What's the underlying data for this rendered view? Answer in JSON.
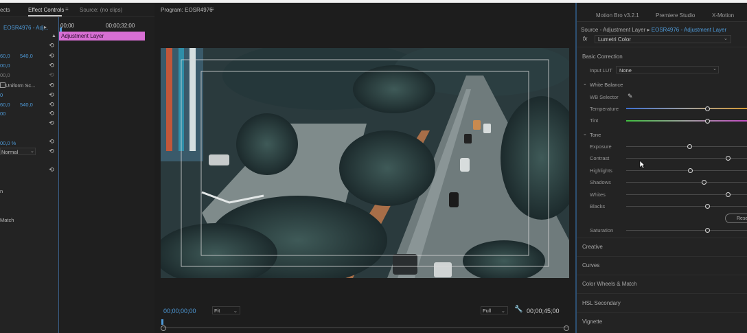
{
  "effect_controls": {
    "tabs": {
      "effects": "ects",
      "effect_controls": "Effect Controls",
      "source": "Source: (no clips)"
    },
    "clip_source": "EOSR4976 - Adj...",
    "timecode_start": "00;00",
    "timecode_end": "00;00;32;00",
    "adjustment_bar_label": "Adjustment Layer",
    "values": {
      "pos_x": "60,0",
      "pos_y": "540,0",
      "scale": "00,0",
      "scale_w": "00,0",
      "uniform_scale": "Uniform Sc...",
      "rotation": "0",
      "anchor_x": "60,0",
      "anchor_y": "540,0",
      "flicker": "00",
      "opacity": "00,0 %",
      "blend_mode": "Normal",
      "row_n": "n",
      "match": "Match"
    }
  },
  "program": {
    "title": "Program: EOSR4976",
    "timecode": "00;00;00;00",
    "fit": "Fit",
    "quality": "Full",
    "duration": "00;00;45;00"
  },
  "lumetri": {
    "tabs": [
      "Motion Bro v3.2.1",
      "Premiere Studio",
      "X-Motion"
    ],
    "source": "Source - Adjustment Layer",
    "clip": "EOSR4976 - Adjustment Layer",
    "fx": "fx",
    "effect": "Lumetri Color",
    "basic_correction": "Basic Correction",
    "input_lut_label": "Input LUT",
    "input_lut_value": "None",
    "white_balance": "White Balance",
    "wb_selector": "WB Selector",
    "temperature": "Temperature",
    "tint": "Tint",
    "tone": "Tone",
    "exposure": "Exposure",
    "contrast": "Contrast",
    "highlights": "Highlights",
    "shadows": "Shadows",
    "whites": "Whites",
    "blacks": "Blacks",
    "reset": "Rese",
    "saturation": "Saturation",
    "sections": [
      "Creative",
      "Curves",
      "Color Wheels & Match",
      "HSL Secondary",
      "Vignette"
    ],
    "slider_levels": {
      "temperature": 0.67,
      "tint": 0.67,
      "exposure": 0.52,
      "contrast": 0.84,
      "highlights": 0.53,
      "shadows": 0.64,
      "whites": 0.84,
      "blacks": 0.67,
      "saturation": 0.67
    }
  }
}
